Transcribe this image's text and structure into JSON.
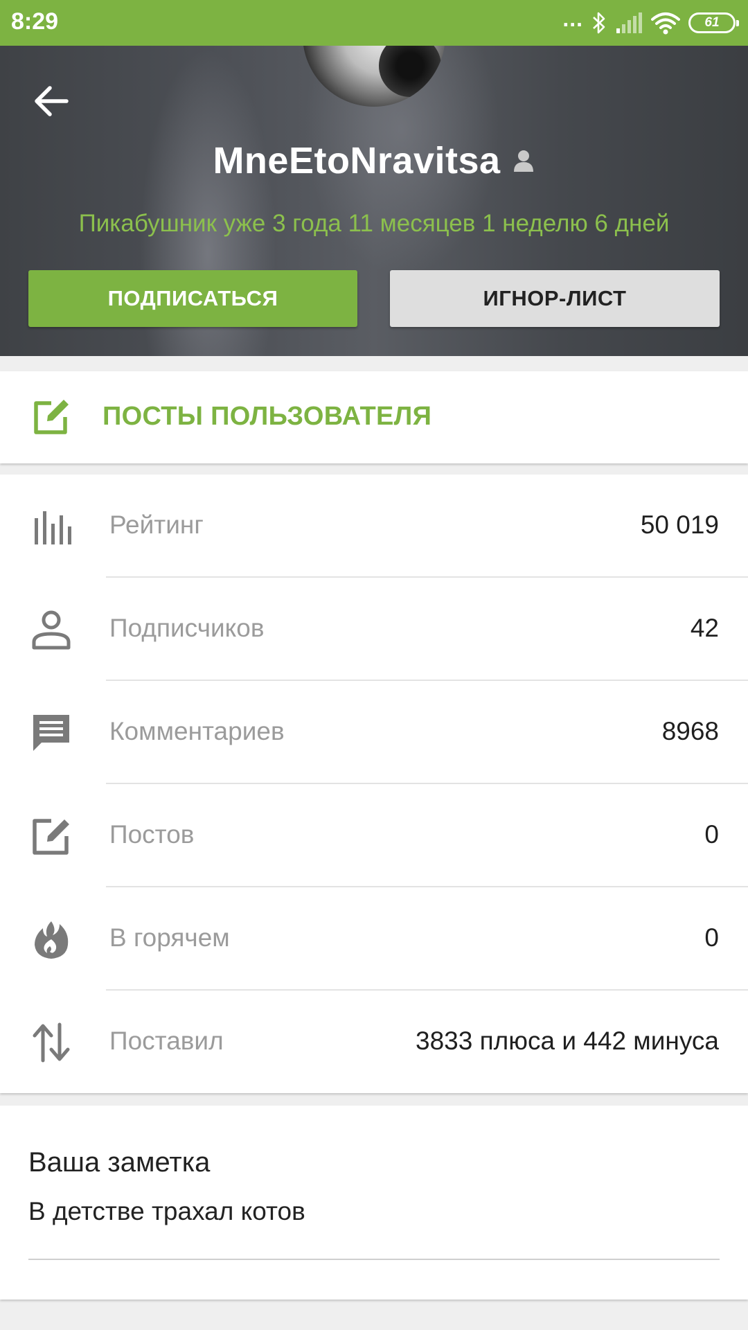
{
  "status_bar": {
    "time": "8:29",
    "dots": "...",
    "battery": "61",
    "icons": [
      "bluetooth-icon",
      "signal-icon",
      "wifi-icon",
      "battery-icon"
    ]
  },
  "header": {
    "username": "MneEtoNravitsa",
    "tenure": "Пикабушник уже 3 года 11 месяцев 1 неделю 6 дней",
    "subscribe_label": "ПОДПИСАТЬСЯ",
    "ignore_label": "ИГНОР-ЛИСТ"
  },
  "posts_link": {
    "label": "ПОСТЫ ПОЛЬЗОВАТЕЛЯ",
    "icon": "edit-icon"
  },
  "stats": [
    {
      "icon": "rating-bars-icon",
      "label": "Рейтинг",
      "value": "50 019"
    },
    {
      "icon": "person-icon",
      "label": "Подписчиков",
      "value": "42"
    },
    {
      "icon": "comment-icon",
      "label": "Комментариев",
      "value": "8968"
    },
    {
      "icon": "edit-icon",
      "label": "Постов",
      "value": "0"
    },
    {
      "icon": "fire-icon",
      "label": "В горячем",
      "value": "0"
    },
    {
      "icon": "up-down-arrows-icon",
      "label": "Поставил",
      "value": "3833 плюса и 442 минуса"
    }
  ],
  "note": {
    "title": "Ваша заметка",
    "text": "В детстве трахал котов"
  },
  "colors": {
    "accent": "#7db342",
    "tenure_text": "#8cc04d",
    "header_bg": "#4a4d52",
    "label_gray": "#9b9b9b"
  }
}
